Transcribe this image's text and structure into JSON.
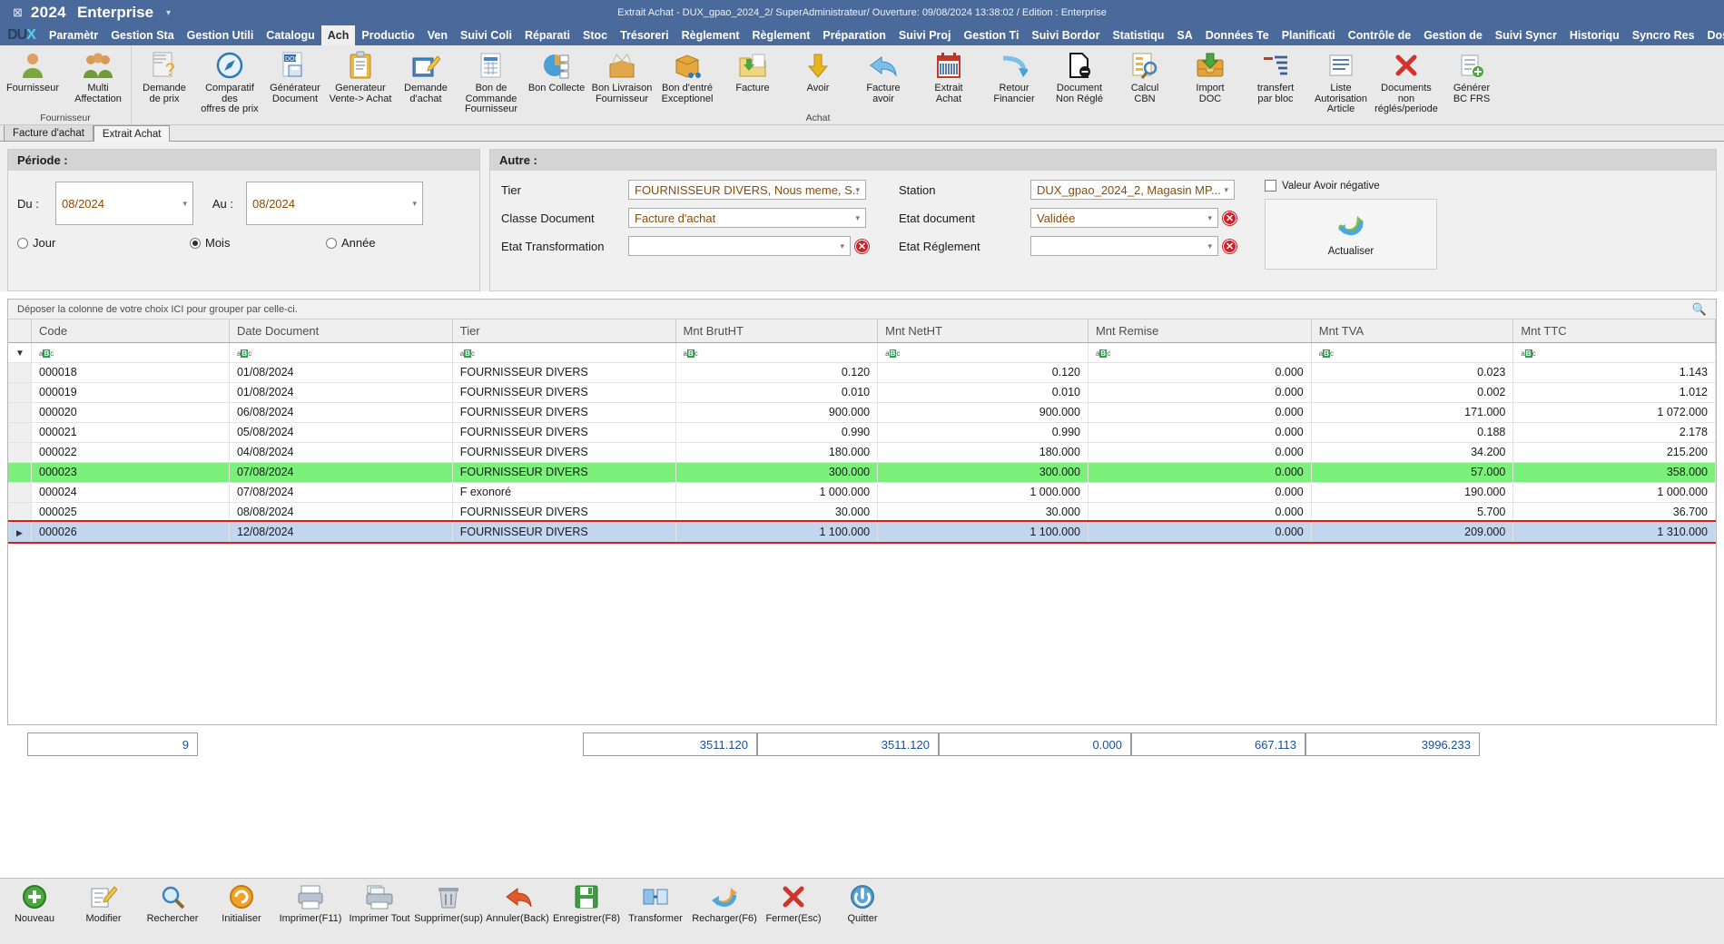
{
  "titlebar": {
    "close_glyph": "⊠",
    "year": "2024",
    "app_name": "Enterprise",
    "caret": "▾",
    "info": "Extrait Achat - DUX_gpao_2024_2/ SuperAdministrateur/ Ouverture: 09/08/2024 13:38:02 / Edition : Enterprise"
  },
  "logo": {
    "pre": "DU",
    "accent": "X"
  },
  "menu": {
    "items": [
      "Paramètr",
      "Gestion Sta",
      "Gestion Utili",
      "Catalogu",
      "Ach",
      "Productio",
      "Ven",
      "Suivi Coli",
      "Réparati",
      "Stoc",
      "Trésoreri",
      "Règlement",
      "Règlement",
      "Préparation",
      "Suivi Proj",
      "Gestion Ti",
      "Suivi Bordor",
      "Statistiqu",
      "SA",
      "Données Te",
      "Planificati",
      "Contrôle de",
      "Gestion de",
      "Suivi Syncr",
      "Historiqu",
      "Syncro Res",
      "Dossier in"
    ],
    "active_index": 4
  },
  "ribbon": {
    "groups": [
      {
        "label": "Fournisseur",
        "buttons": [
          {
            "name": "fournisseur",
            "icon": "person-icon",
            "label": "Fournisseur"
          },
          {
            "name": "multi-affectation",
            "icon": "people-icon",
            "label": "Multi\nAffectation"
          }
        ]
      },
      {
        "label": "Achat",
        "buttons": [
          {
            "name": "demande-de-prix",
            "icon": "document-question-icon",
            "label": "Demande\nde prix"
          },
          {
            "name": "comparatif-offres",
            "icon": "compass-icon",
            "label": "Comparatif des\noffres de prix"
          },
          {
            "name": "generateur-document",
            "icon": "doc-save-icon",
            "label": "Générateur\nDocument"
          },
          {
            "name": "generateur-vente-achat",
            "icon": "clipboard-icon",
            "label": "Generateur\nVente-> Achat"
          },
          {
            "name": "demande-dachat",
            "icon": "notebook-pencil-icon",
            "label": "Demande\nd'achat"
          },
          {
            "name": "bon-commande-fournisseur",
            "icon": "table-doc-icon",
            "label": "Bon de Commande\nFournisseur"
          },
          {
            "name": "bon-collecte",
            "icon": "pie-list-icon",
            "label": "Bon Collecte"
          },
          {
            "name": "bon-livraison-fournisseur",
            "icon": "open-box-icon",
            "label": "Bon Livraison\nFournisseur"
          },
          {
            "name": "bon-entre-exceptionel",
            "icon": "box-cart-icon",
            "label": "Bon d'entré\nExceptionel"
          },
          {
            "name": "facture",
            "icon": "folder-down-icon",
            "label": "Facture"
          },
          {
            "name": "avoir",
            "icon": "arrow-down-icon",
            "label": "Avoir"
          },
          {
            "name": "facture-avoir",
            "icon": "arrow-back-icon",
            "label": "Facture\navoir"
          },
          {
            "name": "extrait-achat",
            "icon": "calendar-barcode-icon",
            "label": "Extrait\nAchat"
          },
          {
            "name": "retour-financier",
            "icon": "arrow-curve-icon",
            "label": "Retour\nFinancier"
          },
          {
            "name": "document-non-regle",
            "icon": "doc-block-icon",
            "label": "Document\nNon Réglé"
          },
          {
            "name": "calcul-cbn",
            "icon": "doc-search-icon",
            "label": "Calcul\nCBN"
          },
          {
            "name": "import-doc",
            "icon": "import-tray-icon",
            "label": "Import\nDOC"
          },
          {
            "name": "transfert-par-bloc",
            "icon": "transfer-lines-icon",
            "label": "transfert\npar bloc"
          },
          {
            "name": "liste-autorisation-article",
            "icon": "list-icon",
            "label": "Liste Autorisation\nArticle"
          },
          {
            "name": "documents-non-regles-periode",
            "icon": "red-x-icon",
            "label": "Documents non\nréglés/periode"
          },
          {
            "name": "generer-bc-frs",
            "icon": "generate-icon",
            "label": "Générer\nBC FRS"
          }
        ]
      }
    ]
  },
  "page_tabs": {
    "items": [
      "Facture d'achat",
      "Extrait Achat"
    ],
    "active_index": 1
  },
  "periode": {
    "title": "Période :",
    "du_label": "Du :",
    "du_value": "08/2024",
    "au_label": "Au :",
    "au_value": "08/2024",
    "radios": [
      {
        "label": "Jour",
        "selected": false
      },
      {
        "label": "Mois",
        "selected": true
      },
      {
        "label": "Année",
        "selected": false
      }
    ]
  },
  "autre": {
    "title": "Autre :",
    "tier_label": "Tier",
    "tier_value": "FOURNISSEUR DIVERS, Nous meme, S...",
    "classe_document_label": "Classe Document",
    "classe_document_value": "Facture d'achat",
    "etat_transformation_label": "Etat Transformation",
    "etat_transformation_value": "",
    "station_label": "Station",
    "station_value": "DUX_gpao_2024_2, Magasin MP...",
    "etat_document_label": "Etat document",
    "etat_document_value": "Validée",
    "etat_reglement_label": "Etat Réglement",
    "etat_reglement_value": "",
    "valeur_avoir_negative_label": "Valeur Avoir négative",
    "valeur_avoir_negative_checked": false,
    "actualiser_label": "Actualiser",
    "actualiser_icon": "refresh-icon"
  },
  "grid": {
    "group_hint": "Déposer la colonne de votre choix ICI pour grouper par celle-ci.",
    "search_icon": "search-icon",
    "columns": [
      {
        "label": "Code",
        "align": "left"
      },
      {
        "label": "Date Document",
        "align": "left"
      },
      {
        "label": "Tier",
        "align": "left"
      },
      {
        "label": "Mnt BrutHT",
        "align": "right"
      },
      {
        "label": "Mnt NetHT",
        "align": "right"
      },
      {
        "label": "Mnt Remise",
        "align": "right"
      },
      {
        "label": "Mnt TVA",
        "align": "right"
      },
      {
        "label": "Mnt TTC",
        "align": "right"
      }
    ],
    "filter_placeholder": "aBc",
    "rows": [
      {
        "code": "000018",
        "date": "01/08/2024",
        "tier": "FOURNISSEUR DIVERS",
        "brut": "0.120",
        "net": "0.120",
        "remise": "0.000",
        "tva": "0.023",
        "ttc": "1.143",
        "state": ""
      },
      {
        "code": "000019",
        "date": "01/08/2024",
        "tier": "FOURNISSEUR DIVERS",
        "brut": "0.010",
        "net": "0.010",
        "remise": "0.000",
        "tva": "0.002",
        "ttc": "1.012",
        "state": ""
      },
      {
        "code": "000020",
        "date": "06/08/2024",
        "tier": "FOURNISSEUR DIVERS",
        "brut": "900.000",
        "net": "900.000",
        "remise": "0.000",
        "tva": "171.000",
        "ttc": "1 072.000",
        "state": ""
      },
      {
        "code": "000021",
        "date": "05/08/2024",
        "tier": "FOURNISSEUR DIVERS",
        "brut": "0.990",
        "net": "0.990",
        "remise": "0.000",
        "tva": "0.188",
        "ttc": "2.178",
        "state": ""
      },
      {
        "code": "000022",
        "date": "04/08/2024",
        "tier": "FOURNISSEUR DIVERS",
        "brut": "180.000",
        "net": "180.000",
        "remise": "0.000",
        "tva": "34.200",
        "ttc": "215.200",
        "state": ""
      },
      {
        "code": "000023",
        "date": "07/08/2024",
        "tier": "FOURNISSEUR DIVERS",
        "brut": "300.000",
        "net": "300.000",
        "remise": "0.000",
        "tva": "57.000",
        "ttc": "358.000",
        "state": "green"
      },
      {
        "code": "000024",
        "date": "07/08/2024",
        "tier": "F exonoré",
        "brut": "1 000.000",
        "net": "1 000.000",
        "remise": "0.000",
        "tva": "190.000",
        "ttc": "1 000.000",
        "state": ""
      },
      {
        "code": "000025",
        "date": "08/08/2024",
        "tier": "FOURNISSEUR DIVERS",
        "brut": "30.000",
        "net": "30.000",
        "remise": "0.000",
        "tva": "5.700",
        "ttc": "36.700",
        "state": ""
      },
      {
        "code": "000026",
        "date": "12/08/2024",
        "tier": "FOURNISSEUR DIVERS",
        "brut": "1 100.000",
        "net": "1 100.000",
        "remise": "0.000",
        "tva": "209.000",
        "ttc": "1 310.000",
        "state": "selected"
      }
    ]
  },
  "totals": {
    "count": "9",
    "brut": "3511.120",
    "net": "3511.120",
    "remise": "0.000",
    "tva": "667.113",
    "ttc": "3996.233"
  },
  "bottombar": {
    "buttons": [
      {
        "name": "nouveau",
        "icon": "plus-circle-icon",
        "label": "Nouveau"
      },
      {
        "name": "modifier",
        "icon": "pencil-icon",
        "label": "Modifier"
      },
      {
        "name": "rechercher",
        "icon": "magnifier-icon",
        "label": "Rechercher"
      },
      {
        "name": "initialiser",
        "icon": "orange-circle-icon",
        "label": "Initialiser"
      },
      {
        "name": "imprimer-f11",
        "icon": "printer-icon",
        "label": "Imprimer(F11)"
      },
      {
        "name": "imprimer-tout",
        "icon": "printer-all-icon",
        "label": "Imprimer Tout"
      },
      {
        "name": "supprimer-sup",
        "icon": "trash-icon",
        "label": "Supprimer(sup)"
      },
      {
        "name": "annuler-back",
        "icon": "undo-arrow-icon",
        "label": "Annuler(Back)"
      },
      {
        "name": "enregistrer-f8",
        "icon": "save-disk-icon",
        "label": "Enregistrer(F8)"
      },
      {
        "name": "transformer",
        "icon": "transform-icon",
        "label": "Transformer"
      },
      {
        "name": "recharger-f6",
        "icon": "reload-icon",
        "label": "Recharger(F6)"
      },
      {
        "name": "fermer-esc",
        "icon": "red-x-icon",
        "label": "Fermer(Esc)"
      },
      {
        "name": "quitter",
        "icon": "power-icon",
        "label": "Quitter"
      }
    ]
  },
  "colors": {
    "titlebar": "#4a6a9b",
    "selected_row": "#c3d6ef",
    "highlight_row": "#7bf07b",
    "selection_outline": "#e01b1b",
    "total_text": "#1a4f9c",
    "field_text": "#8a4b08"
  }
}
